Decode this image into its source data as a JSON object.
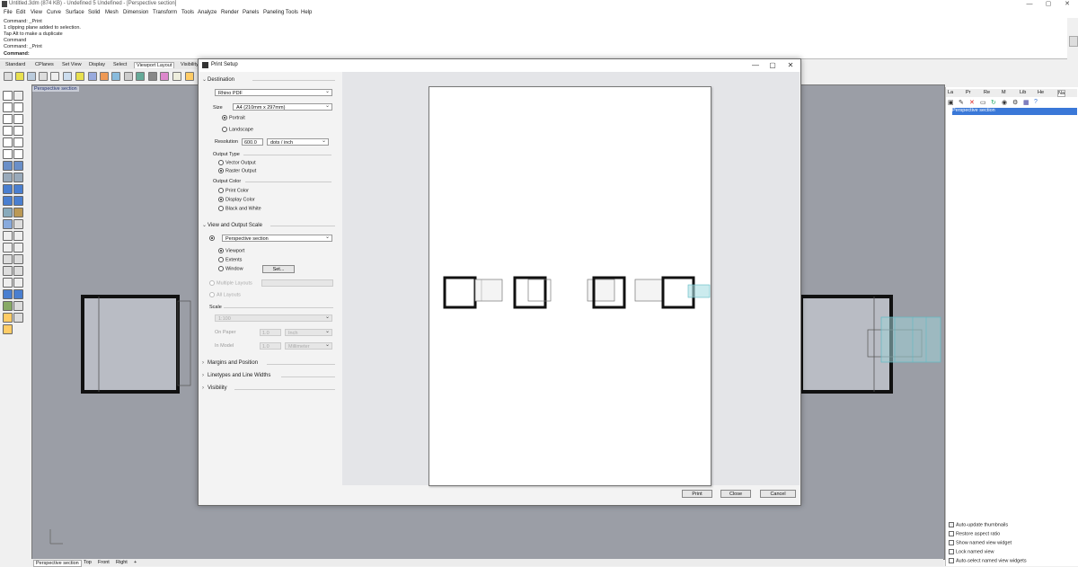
{
  "window": {
    "title": "Untitled.3dm (874 KB) - Undefined 5 Undefined - [Perspective section]",
    "minimize": "—",
    "maximize": "▢",
    "close": "✕"
  },
  "menu": [
    "File",
    "Edit",
    "View",
    "Curve",
    "Surface",
    "Solid",
    "Mesh",
    "Dimension",
    "Transform",
    "Tools",
    "Analyze",
    "Render",
    "Panels",
    "Paneling Tools",
    "Help"
  ],
  "command_history": [
    "Command: _Print",
    "1 clipping plane added to selection.",
    "Tap Alt to make a duplicate",
    "Command",
    "Command: _Print"
  ],
  "command_prompt": "Command:",
  "toolbar_tabs": [
    "Standard",
    "CPlanes",
    "Set View",
    "Display",
    "Select",
    "Viewport Layout",
    "Visibility"
  ],
  "toolbar_active_tab": "Select",
  "viewport": {
    "title": "Perspective section",
    "tabs": [
      "Perspective section",
      "Top",
      "Front",
      "Right",
      "+"
    ],
    "active_tab": "Perspective section"
  },
  "right_panel": {
    "tabs": [
      "La",
      "Pr",
      "Re",
      "M",
      "Lib",
      "He",
      "Na"
    ],
    "selected_view": "Perspective section",
    "options": [
      {
        "label": "Auto-update thumbnails",
        "checked": true
      },
      {
        "label": "Restore aspect ratio",
        "checked": false
      },
      {
        "label": "Show named view widget",
        "checked": false
      },
      {
        "label": "Lock named view",
        "checked": false
      },
      {
        "label": "Auto-select named view widgets",
        "checked": false
      }
    ]
  },
  "dialog": {
    "title": "Print Setup",
    "destination": {
      "header": "Destination",
      "printer": "Rhino PDF",
      "size_label": "Size",
      "size_value": "A4 (210mm x 297mm)",
      "orientation": {
        "portrait": "Portrait",
        "landscape": "Landscape",
        "selected": "Portrait"
      },
      "resolution_label": "Resolution",
      "resolution_value": "600.0",
      "resolution_unit": "dots / inch",
      "output_type_label": "Output Type",
      "output_type": {
        "vector": "Vector Output",
        "raster": "Raster Output",
        "selected": "Raster Output"
      },
      "output_color_label": "Output Color",
      "output_color": {
        "print": "Print Color",
        "display": "Display Color",
        "bw": "Black and White",
        "selected": "Display Color"
      }
    },
    "view": {
      "header": "View and Output Scale",
      "view_name": "Perspective section",
      "area": {
        "viewport": "Viewport",
        "extents": "Extents",
        "window": "Window",
        "selected": "Viewport"
      },
      "set_button": "Set...",
      "multiple_layouts": "Multiple Layouts",
      "all_layouts": "All Layouts",
      "scale_label": "Scale",
      "scale_value": "1:100",
      "on_paper_label": "On Paper",
      "on_paper_value": "1.0",
      "on_paper_unit": "Inch",
      "in_model_label": "In Model",
      "in_model_value": "1.0",
      "in_model_unit": "Millimeter"
    },
    "collapsed_sections": [
      "Margins and Position",
      "Linetypes and Line Widths",
      "Visibility"
    ],
    "buttons": {
      "print": "Print",
      "close": "Close",
      "cancel": "Cancel"
    }
  }
}
